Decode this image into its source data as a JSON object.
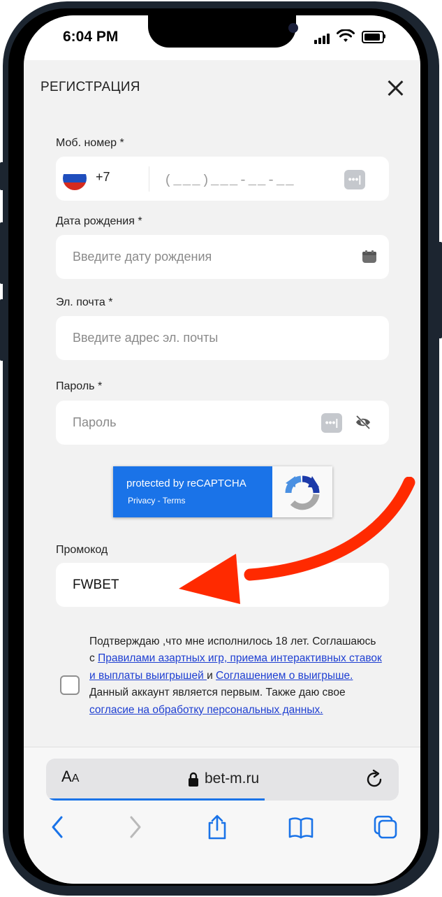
{
  "status_bar": {
    "time": "6:04 PM"
  },
  "header": {
    "title": "РЕГИСТРАЦИЯ"
  },
  "form": {
    "phone": {
      "label": "Моб. номер *",
      "country_code": "+7",
      "placeholder": "(___)___-__-__"
    },
    "birthdate": {
      "label": "Дата рождения *",
      "placeholder": "Введите дату рождения"
    },
    "email": {
      "label": "Эл. почта *",
      "placeholder": "Введите адрес эл. почты"
    },
    "password": {
      "label": "Пароль *",
      "placeholder": "Пароль"
    },
    "recaptcha": {
      "title": "protected by reCAPTCHA",
      "privacy": "Privacy",
      "separator": " - ",
      "terms": "Terms"
    },
    "promo": {
      "label": "Промокод",
      "value": "FWBET"
    },
    "agreement": {
      "text1": "Подтверждаю ,что мне исполнилось 18 лет. Соглашаюсь с ",
      "link1": "Правилами азартных игр, приема интерактивных ставок и выплаты выигрышей ",
      "text2": "и ",
      "link2": "Соглашением о выигрыше.",
      "text3": " Данный аккаунт является первым. Также даю свое ",
      "link3": "согласие на обработку персональных данных.",
      "checked": false
    }
  },
  "browser": {
    "text_size_label_big": "A",
    "text_size_label_small": "A",
    "url": "bet-m.ru",
    "load_progress": 0.62
  },
  "colors": {
    "accent": "#1a73e8",
    "annotation_arrow": "#ff2a00",
    "link": "#1e3fd2"
  }
}
